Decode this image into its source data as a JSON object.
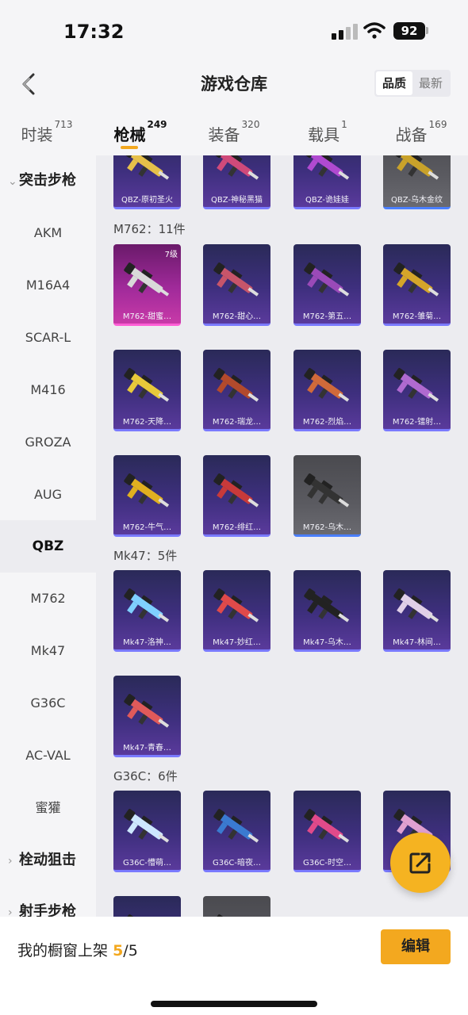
{
  "status": {
    "time": "17:32",
    "battery": "92"
  },
  "nav": {
    "title": "游戏仓库",
    "sort_options": [
      "品质",
      "最新"
    ],
    "sort_active": "品质"
  },
  "tabs": [
    {
      "label": "时装",
      "count": "713"
    },
    {
      "label": "枪械",
      "count": "249",
      "active": true
    },
    {
      "label": "装备",
      "count": "320"
    },
    {
      "label": "载具",
      "count": "1"
    },
    {
      "label": "战备",
      "count": "169"
    }
  ],
  "sidebar": {
    "group_assault": "突击步枪",
    "items": [
      "AKM",
      "M16A4",
      "SCAR-L",
      "M416",
      "GROZA",
      "AUG",
      "QBZ",
      "M762",
      "Mk47",
      "G36C",
      "AC-VAL",
      "蜜獾"
    ],
    "selected": "QBZ",
    "group_bolt": "栓动狙击",
    "group_dmr": "射手步枪"
  },
  "sections": {
    "m762": "M762：11件",
    "mk47": "Mk47：5件",
    "g36c": "G36C：6件"
  },
  "cards": {
    "qbz": [
      "QBZ-原初圣火",
      "QBZ-神秘黑猫",
      "QBZ-诡娃娃",
      "QBZ-乌木金纹"
    ],
    "m762": [
      "M762-甜蜜…",
      "M762-甜心…",
      "M762-第五…",
      "M762-雏菊…",
      "M762-天降…",
      "M762-瑞龙…",
      "M762-烈焰…",
      "M762-镭射…",
      "M762-牛气…",
      "M762-绯红…",
      "M762-乌木…"
    ],
    "m762_level": "7级",
    "mk47": [
      "Mk47-洛神…",
      "Mk47-妙红…",
      "Mk47-乌木…",
      "Mk47-林间…",
      "Mk47-青春…"
    ],
    "g36c": [
      "G36C-懵萌…",
      "G36C-暗夜…",
      "G36C-时空…"
    ]
  },
  "bottom": {
    "label": "我的橱窗上架",
    "shown": "5",
    "total": "/5",
    "edit_label": "编辑"
  },
  "colors": {
    "accent": "#f3a81f",
    "card_purple": "#3e2f7e",
    "card_pink": "#c83aa8"
  }
}
